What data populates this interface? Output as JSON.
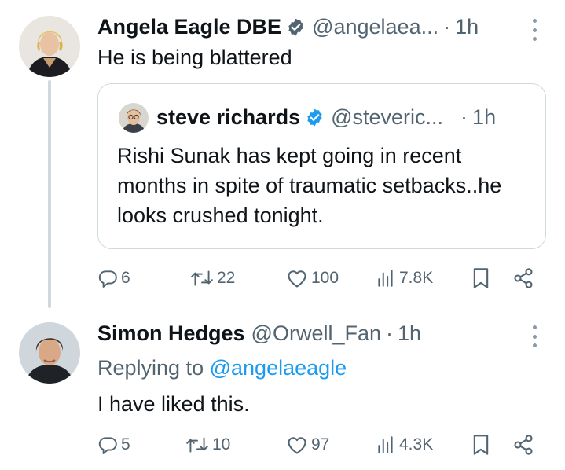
{
  "posts": [
    {
      "name": "Angela Eagle DBE",
      "verified": true,
      "handle": "@angelaea...",
      "dot": "·",
      "time": "1h",
      "text": "He is being blattered",
      "quote": {
        "name": "steve richards",
        "verified": true,
        "handle": "@steveric...",
        "dot": "·",
        "time": "1h",
        "text": "Rishi Sunak has kept going in recent months in spite of traumatic setbacks..he looks crushed tonight."
      },
      "actions": {
        "replies": "6",
        "reposts": "22",
        "likes": "100",
        "views": "7.8K"
      }
    },
    {
      "name": "Simon Hedges",
      "verified": false,
      "handle": "@Orwell_Fan",
      "dot": "·",
      "time": "1h",
      "replying_prefix": "Replying to",
      "replying_to": "@angelaeagle",
      "text": "I have liked this.",
      "actions": {
        "replies": "5",
        "reposts": "10",
        "likes": "97",
        "views": "4.3K"
      }
    }
  ],
  "colors": {
    "accent": "#1d9bf0",
    "secondary_text": "#536471",
    "border": "#cfd9de"
  }
}
